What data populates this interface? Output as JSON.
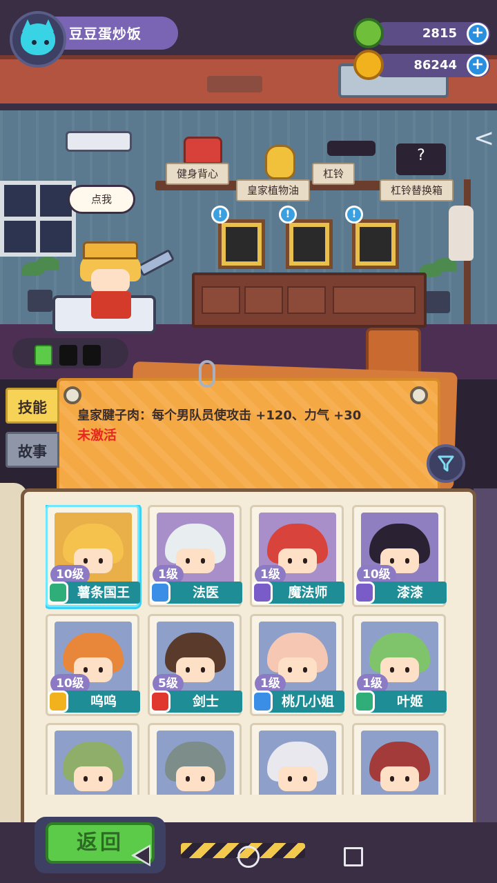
{
  "player": {
    "name": "豆豆蛋炒饭",
    "avatar_icon": "cat-avatar-icon"
  },
  "currencies": [
    {
      "name": "donut",
      "icon": "donut-coin-icon",
      "value": "2815",
      "color": "#6fbf3a"
    },
    {
      "name": "planet-coin",
      "icon": "planet-coin-icon",
      "value": "86244",
      "color": "#f2b21e"
    }
  ],
  "room": {
    "speech_bubble": "点我",
    "gym_items": [
      {
        "label": "健身背心",
        "icon": "vest-icon"
      },
      {
        "label": "皇家植物油",
        "icon": "oil-bottle-icon"
      },
      {
        "label": "杠铃",
        "icon": "barbell-icon"
      },
      {
        "label": "杠铃替换箱",
        "icon": "barbell-box-icon"
      }
    ]
  },
  "tabs": [
    {
      "label": "技能",
      "active": true
    },
    {
      "label": "故事",
      "active": false
    }
  ],
  "skill_panel": {
    "description": "皇家腱子肉：每个男队员使攻击 +120、力气 +30",
    "status": "未激活",
    "status_color": "#e8281e"
  },
  "characters": [
    {
      "name": "薯条国王",
      "level": "10级",
      "class_color": "#2fae7a",
      "hair": "#f4c24d",
      "bg": "#e9b04a",
      "selected": true
    },
    {
      "name": "法医",
      "level": "1级",
      "class_color": "#3a8ee6",
      "hair": "#e8edf0",
      "bg": "#a88fc9",
      "selected": false
    },
    {
      "name": "魔法师",
      "level": "1级",
      "class_color": "#7a5cc8",
      "hair": "#d8443b",
      "bg": "#a88fc9",
      "selected": false
    },
    {
      "name": "漆漆",
      "level": "10级",
      "class_color": "#7a5cc8",
      "hair": "#2a2233",
      "bg": "#8f7ec0",
      "selected": false
    },
    {
      "name": "呜呜",
      "level": "10级",
      "class_color": "#f2b21e",
      "hair": "#e8873a",
      "bg": "#8ea0c9",
      "selected": false
    },
    {
      "name": "剑士",
      "level": "5级",
      "class_color": "#e0382e",
      "hair": "#5a3a2a",
      "bg": "#8ea0c9",
      "selected": false
    },
    {
      "name": "桃几小姐",
      "level": "1级",
      "class_color": "#3a8ee6",
      "hair": "#f6c8b4",
      "bg": "#8ea0c9",
      "selected": false
    },
    {
      "name": "叶姬",
      "level": "1级",
      "class_color": "#2fae7a",
      "hair": "#7fc46a",
      "bg": "#8ea0c9",
      "selected": false
    },
    {
      "name": "",
      "level": "",
      "class_color": "#f2b21e",
      "hair": "#8fae6a",
      "bg": "#8ea0c9",
      "selected": false
    },
    {
      "name": "",
      "level": "",
      "class_color": "#f2b21e",
      "hair": "#7d8d8a",
      "bg": "#8ea0c9",
      "selected": false
    },
    {
      "name": "",
      "level": "",
      "class_color": "#f2b21e",
      "hair": "#e8e8ee",
      "bg": "#8ea0c9",
      "selected": false
    },
    {
      "name": "",
      "level": "",
      "class_color": "#f2b21e",
      "hair": "#a33b3b",
      "bg": "#8ea0c9",
      "selected": false
    }
  ],
  "footer": {
    "back_label": "返回"
  }
}
